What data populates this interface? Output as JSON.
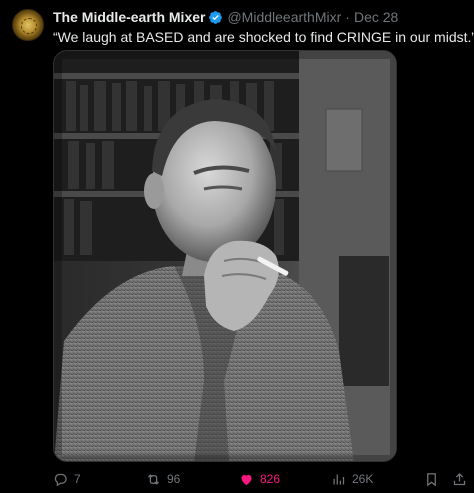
{
  "tweet": {
    "display_name": "The Middle-earth Mixer",
    "handle": "@MiddleearthMixr",
    "separator": "·",
    "date": "Dec 28",
    "text": "“We laugh at BASED and are shocked to find CRINGE in our midst.”",
    "verified_icon": "verified-badge-icon",
    "media": {
      "description_icon": "photo-image",
      "tone": "black-and-white"
    }
  },
  "actions": {
    "reply_count": "7",
    "retweet_count": "96",
    "like_count": "826",
    "views_count": "26K",
    "liked": true,
    "like_color": "#f91880",
    "muted_color": "#71767b",
    "accent_color": "#1d9bf0"
  }
}
